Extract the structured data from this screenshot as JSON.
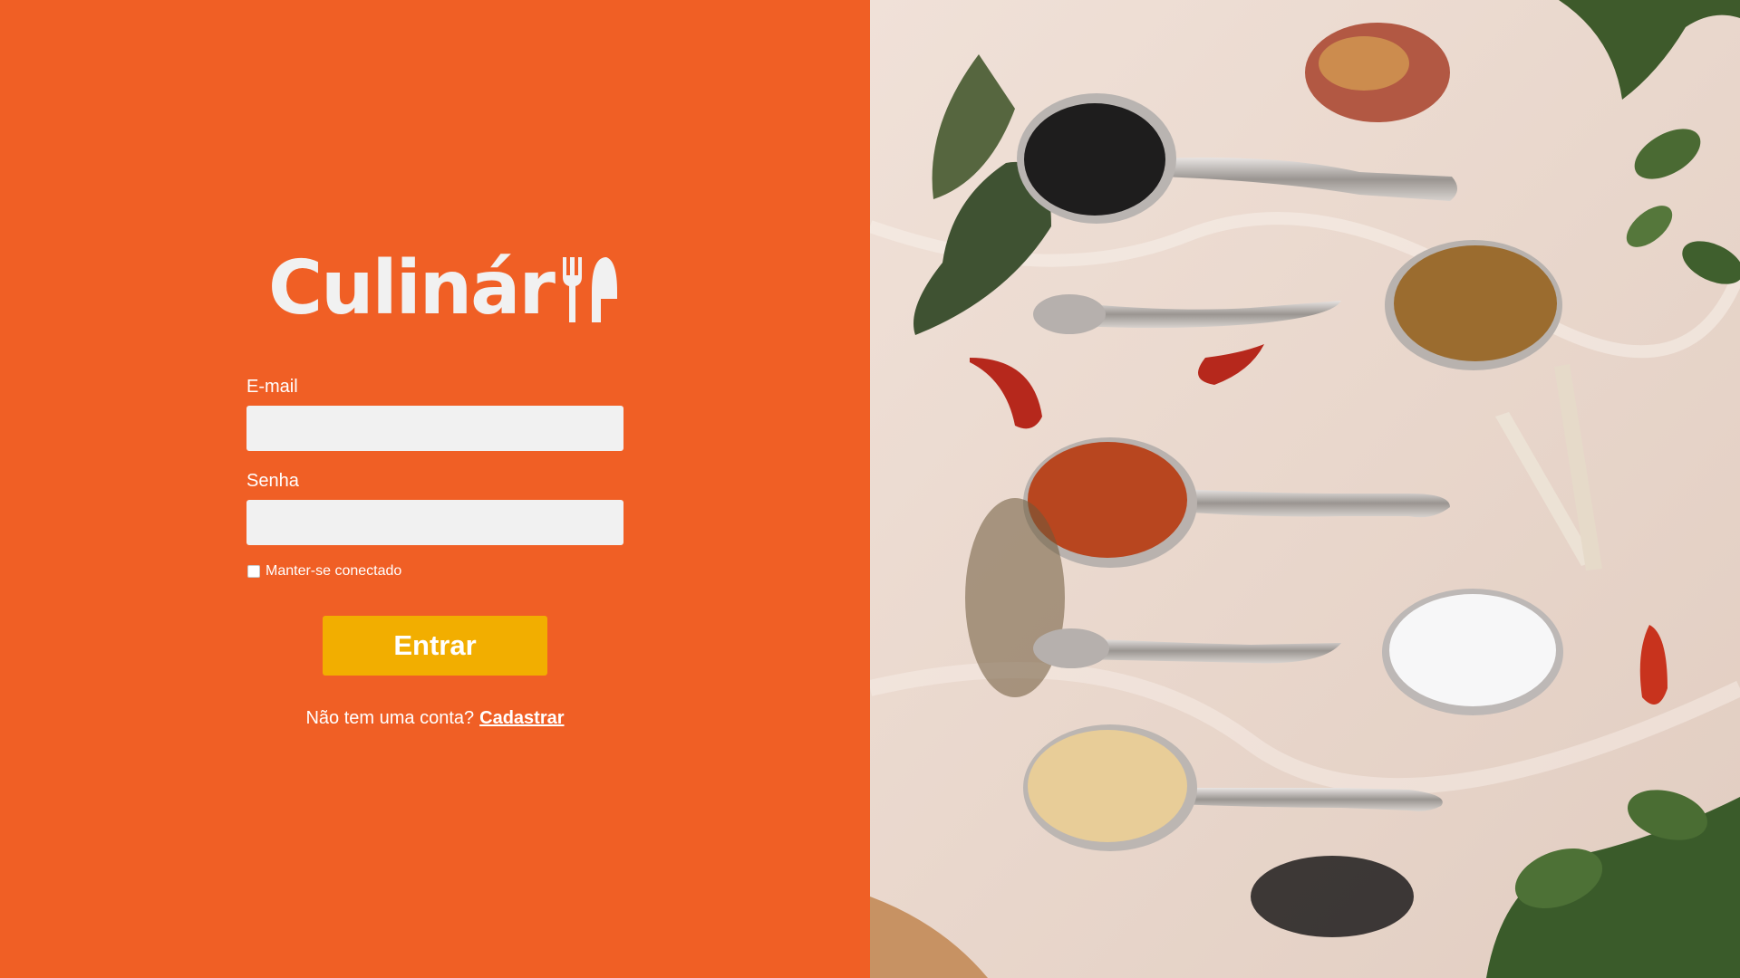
{
  "brand": {
    "name": "Culinár"
  },
  "form": {
    "email_label": "E-mail",
    "email_value": "",
    "password_label": "Senha",
    "password_value": "",
    "remember_label": "Manter-se conectado",
    "remember_checked": false,
    "submit_label": "Entrar"
  },
  "signup": {
    "prompt": "Não tem uma conta?",
    "link_label": "Cadastrar"
  },
  "colors": {
    "background": "#f05f25",
    "button": "#f2ae00",
    "input": "#f1f1f1",
    "text": "#ffffff"
  },
  "photo": {
    "subject": "spices-on-spoons"
  }
}
